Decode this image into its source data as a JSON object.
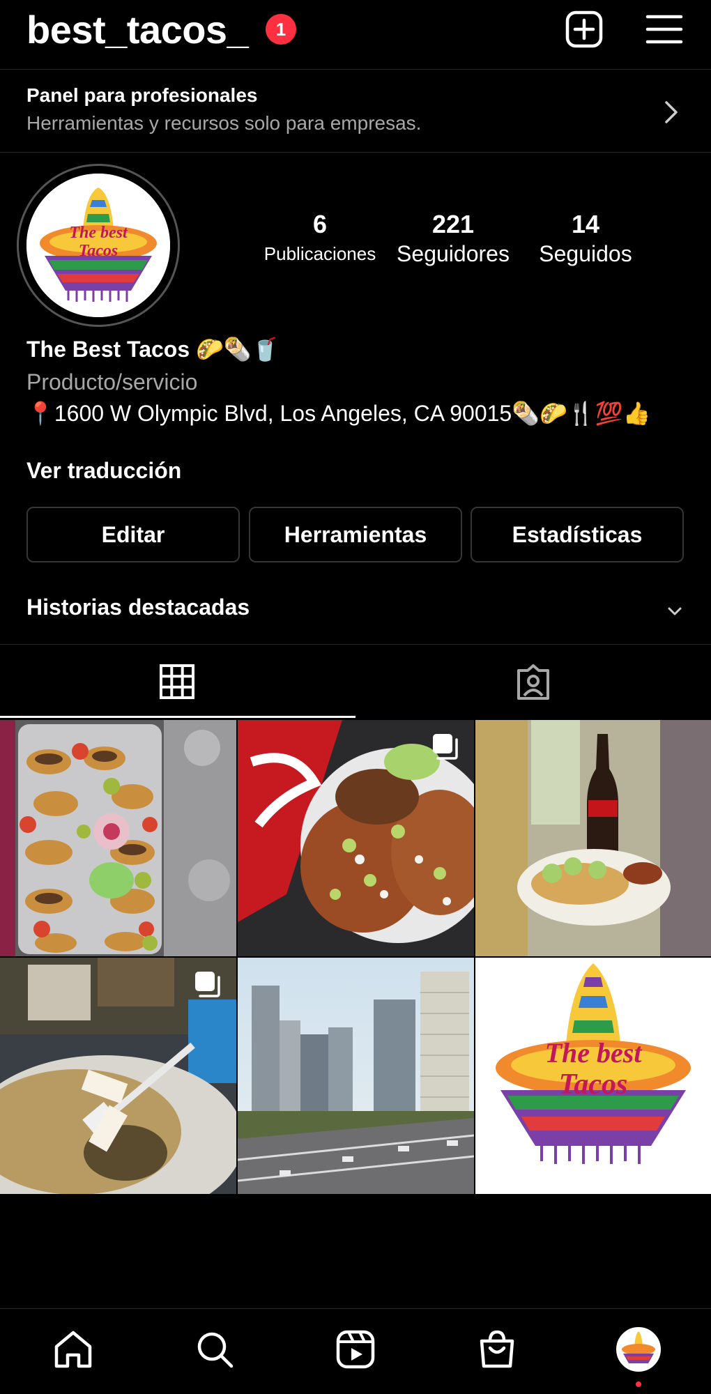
{
  "header": {
    "username": "best_tacos_",
    "notification_count": "1",
    "icons": [
      "plus-square-icon",
      "hamburger-menu-icon"
    ]
  },
  "pro_panel": {
    "title": "Panel para profesionales",
    "subtitle": "Herramientas y recursos solo para empresas."
  },
  "profile": {
    "stats": [
      {
        "value": "6",
        "label": "Publicaciones"
      },
      {
        "value": "221",
        "label": "Seguidores"
      },
      {
        "value": "14",
        "label": "Seguidos"
      }
    ],
    "name": "The Best Tacos 🌮🌯🥤",
    "category": "Producto/servicio",
    "address": "📍1600 W Olympic Blvd, Los Angeles, CA 90015🌯🌮🍴💯👍",
    "translate_link": "Ver traducción",
    "avatar_logo": {
      "line1": "The best",
      "line2": "Tacos"
    }
  },
  "actions": {
    "edit": "Editar",
    "tools": "Herramientas",
    "stats": "Estadísticas"
  },
  "highlights": {
    "label": "Historias destacadas"
  },
  "tabs": [
    {
      "icon": "grid-icon",
      "active": true
    },
    {
      "icon": "tagged-person-icon",
      "active": false
    }
  ],
  "posts": [
    {
      "subject": "tray of tacos with salsas",
      "multi": false
    },
    {
      "subject": "tacos with coca-cola",
      "multi": true
    },
    {
      "subject": "coca-cola bottle with nachos",
      "multi": false
    },
    {
      "subject": "burrito with fork",
      "multi": true
    },
    {
      "subject": "los angeles skyline freeway",
      "multi": false
    },
    {
      "subject": "the best tacos logo",
      "multi": false,
      "logo_line1": "The best",
      "logo_line2": "Tacos"
    }
  ],
  "bottom_nav": [
    "home-icon",
    "search-icon",
    "reels-icon",
    "shop-icon",
    "profile-avatar"
  ],
  "colors": {
    "background": "#000000",
    "badge": "#ff3040",
    "secondary_text": "#a8a8a8",
    "divider": "#262626"
  }
}
